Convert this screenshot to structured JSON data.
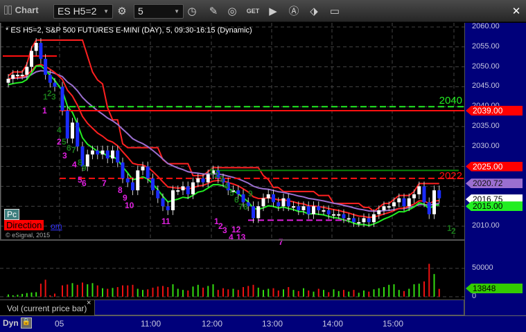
{
  "toolbar": {
    "title": "Chart",
    "symbol": "ES H5=2",
    "interval": "5"
  },
  "header": "* ES H5=2, S&P 500 FUTURES E-MINI (DAY), 5, 09:30-16:15 (Dynamic)",
  "price_axis": {
    "labels": [
      "2060.00",
      "2055.00",
      "2050.00",
      "2045.00",
      "2040.00",
      "2035.00",
      "2030.00",
      "2025.00",
      "2020.00",
      "2015.00",
      "2010.00"
    ],
    "tags": [
      {
        "text": "2039.00",
        "bg": "#ff0000",
        "fg": "#fff"
      },
      {
        "text": "2025.00",
        "bg": "#ff0000",
        "fg": "#fff"
      },
      {
        "text": "2020.72",
        "bg": "#9b6fd0",
        "fg": "#111"
      },
      {
        "text": "2016.75",
        "bg": "#ffffff",
        "fg": "#000"
      },
      {
        "text": "2015.00",
        "bg": "#22ee22",
        "fg": "#000"
      }
    ]
  },
  "levels": {
    "l2040": "2040",
    "l2022": "2022"
  },
  "badges": {
    "pc": "Pc",
    "direction": "Direction",
    "om": "om",
    "copyright": "© eSignal, 2015"
  },
  "volume": {
    "label": "Vol (current price bar)",
    "close": "×",
    "axis": [
      "50000",
      "0"
    ],
    "tag": "13848"
  },
  "bottom": {
    "dyn": "Dyn",
    "times": [
      "05",
      "11:00",
      "12:00",
      "13:00",
      "14:00",
      "15:00"
    ]
  },
  "annotations": [
    {
      "t": "1",
      "c": "#1a7a1a"
    },
    {
      "t": "2",
      "c": "#1a7a1a"
    },
    {
      "t": "3",
      "c": "#1a7a1a"
    },
    {
      "t": "1",
      "c": "#e020e0"
    },
    {
      "t": "4",
      "c": "#1a7a1a"
    },
    {
      "t": "2",
      "c": "#e020e0"
    },
    {
      "t": "5",
      "c": "#1a7a1a"
    },
    {
      "t": "6",
      "c": "#1a7a1a"
    },
    {
      "t": "7",
      "c": "#1a7a1a"
    },
    {
      "t": "3",
      "c": "#e020e0"
    },
    {
      "t": "4",
      "c": "#e020e0"
    },
    {
      "t": "8",
      "c": "#1a7a1a"
    },
    {
      "t": "9",
      "c": "#1a7a1a"
    },
    {
      "t": "5",
      "c": "#e020e0"
    },
    {
      "t": "6",
      "c": "#e020e0"
    },
    {
      "t": "7",
      "c": "#e020e0"
    },
    {
      "t": "8",
      "c": "#e020e0"
    },
    {
      "t": "9",
      "c": "#e020e0"
    },
    {
      "t": "10",
      "c": "#e020e0"
    },
    {
      "t": "11",
      "c": "#e020e0"
    },
    {
      "t": "1",
      "c": "#1a7a1a"
    },
    {
      "t": "2",
      "c": "#1a7a1a"
    },
    {
      "t": "3",
      "c": "#1a7a1a"
    },
    {
      "t": "4",
      "c": "#1a7a1a"
    },
    {
      "t": "5",
      "c": "#1a7a1a"
    },
    {
      "t": "6",
      "c": "#1a7a1a"
    },
    {
      "t": "7",
      "c": "#1a7a1a"
    },
    {
      "t": "8",
      "c": "#1a7a1a"
    },
    {
      "t": "9",
      "c": "#1a7a1a"
    },
    {
      "t": "1",
      "c": "#e020e0"
    },
    {
      "t": "2",
      "c": "#e020e0"
    },
    {
      "t": "3",
      "c": "#e020e0"
    },
    {
      "t": "12",
      "c": "#e020e0"
    },
    {
      "t": "4",
      "c": "#e020e0"
    },
    {
      "t": "13",
      "c": "#e020e0"
    },
    {
      "t": "7",
      "c": "#e020e0"
    },
    {
      "t": "1",
      "c": "#1a7a1a"
    },
    {
      "t": "2",
      "c": "#1a7a1a"
    }
  ],
  "chart_data": {
    "type": "candlestick",
    "prev_closes": [
      2047,
      2048,
      2048,
      2048,
      2050,
      2054,
      2056,
      2052,
      2048,
      2046,
      2045
    ],
    "closes": [
      2039,
      2032,
      2036,
      2030,
      2025,
      2028,
      2029,
      2028,
      2029,
      2027,
      2029,
      2026,
      2022,
      2021,
      2019,
      2024,
      2025,
      2022,
      2019,
      2017,
      2015,
      2014,
      2019,
      2019,
      2020,
      2018,
      2021,
      2022,
      2021,
      2023,
      2024,
      2022,
      2021,
      2019,
      2019,
      2018,
      2016,
      2015,
      2012,
      2015,
      2017,
      2018,
      2016,
      2015,
      2017,
      2015,
      2015,
      2014,
      2015,
      2013,
      2015,
      2014,
      2014,
      2013,
      2013,
      2013,
      2012,
      2012,
      2011,
      2011,
      2012,
      2011,
      2013,
      2014,
      2015,
      2015,
      2016,
      2017,
      2015,
      2017,
      2018,
      2020,
      2016,
      2013,
      2019,
      2017
    ],
    "volume_prev": [
      4000,
      2500,
      3500,
      5000,
      6500,
      7500,
      8000,
      23000,
      30000,
      2500,
      5500
    ],
    "volume": [
      20000,
      21500,
      24000,
      21000,
      25000,
      22000,
      24000,
      20000,
      15000,
      14000,
      15500,
      17000,
      20000,
      20000,
      21000,
      14000,
      12000,
      13000,
      16000,
      18000,
      19000,
      17000,
      22000,
      14000,
      12000,
      11000,
      18000,
      21000,
      16000,
      19000,
      22000,
      12000,
      15000,
      13000,
      14000,
      12000,
      17000,
      19000,
      21000,
      16000,
      12000,
      14000,
      15000,
      11000,
      13000,
      17000,
      12000,
      10000,
      15000,
      11000,
      9000,
      14000,
      12000,
      8000,
      13000,
      10000,
      12000,
      9000,
      12000,
      7000,
      11000,
      9000,
      13000,
      15000,
      17000,
      21000,
      22000,
      12000,
      10000,
      14000,
      22000,
      23000,
      27000,
      58000,
      40000,
      13848
    ],
    "ylim": [
      2007,
      2061
    ]
  }
}
